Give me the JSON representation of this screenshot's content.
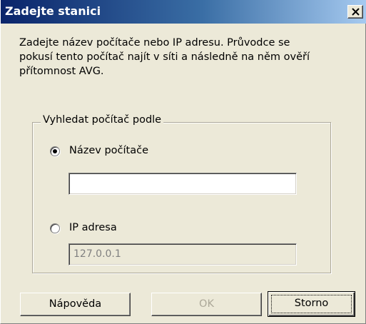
{
  "window": {
    "title": "Zadejte stanici"
  },
  "description": {
    "lines": [
      "Zadejte název počítače nebo IP adresu. Průvodce se",
      "pokusí tento počítač najít v síti a následně na něm ověří",
      "přítomnost AVG."
    ]
  },
  "group": {
    "legend": "Vyhledat počítač podle",
    "options": [
      {
        "label": "Název počítače",
        "selected": true,
        "input_value": "",
        "input_enabled": true
      },
      {
        "label": "IP adresa",
        "selected": false,
        "input_value": "127.0.0.1",
        "input_enabled": false
      }
    ]
  },
  "buttons": {
    "help": "Nápověda",
    "ok": "OK",
    "cancel": "Storno"
  },
  "colors": {
    "title_gradient_start": "#0a246a",
    "title_gradient_end": "#a6caf0",
    "face": "#ece9d8"
  },
  "icons": {
    "close": "close-icon"
  }
}
